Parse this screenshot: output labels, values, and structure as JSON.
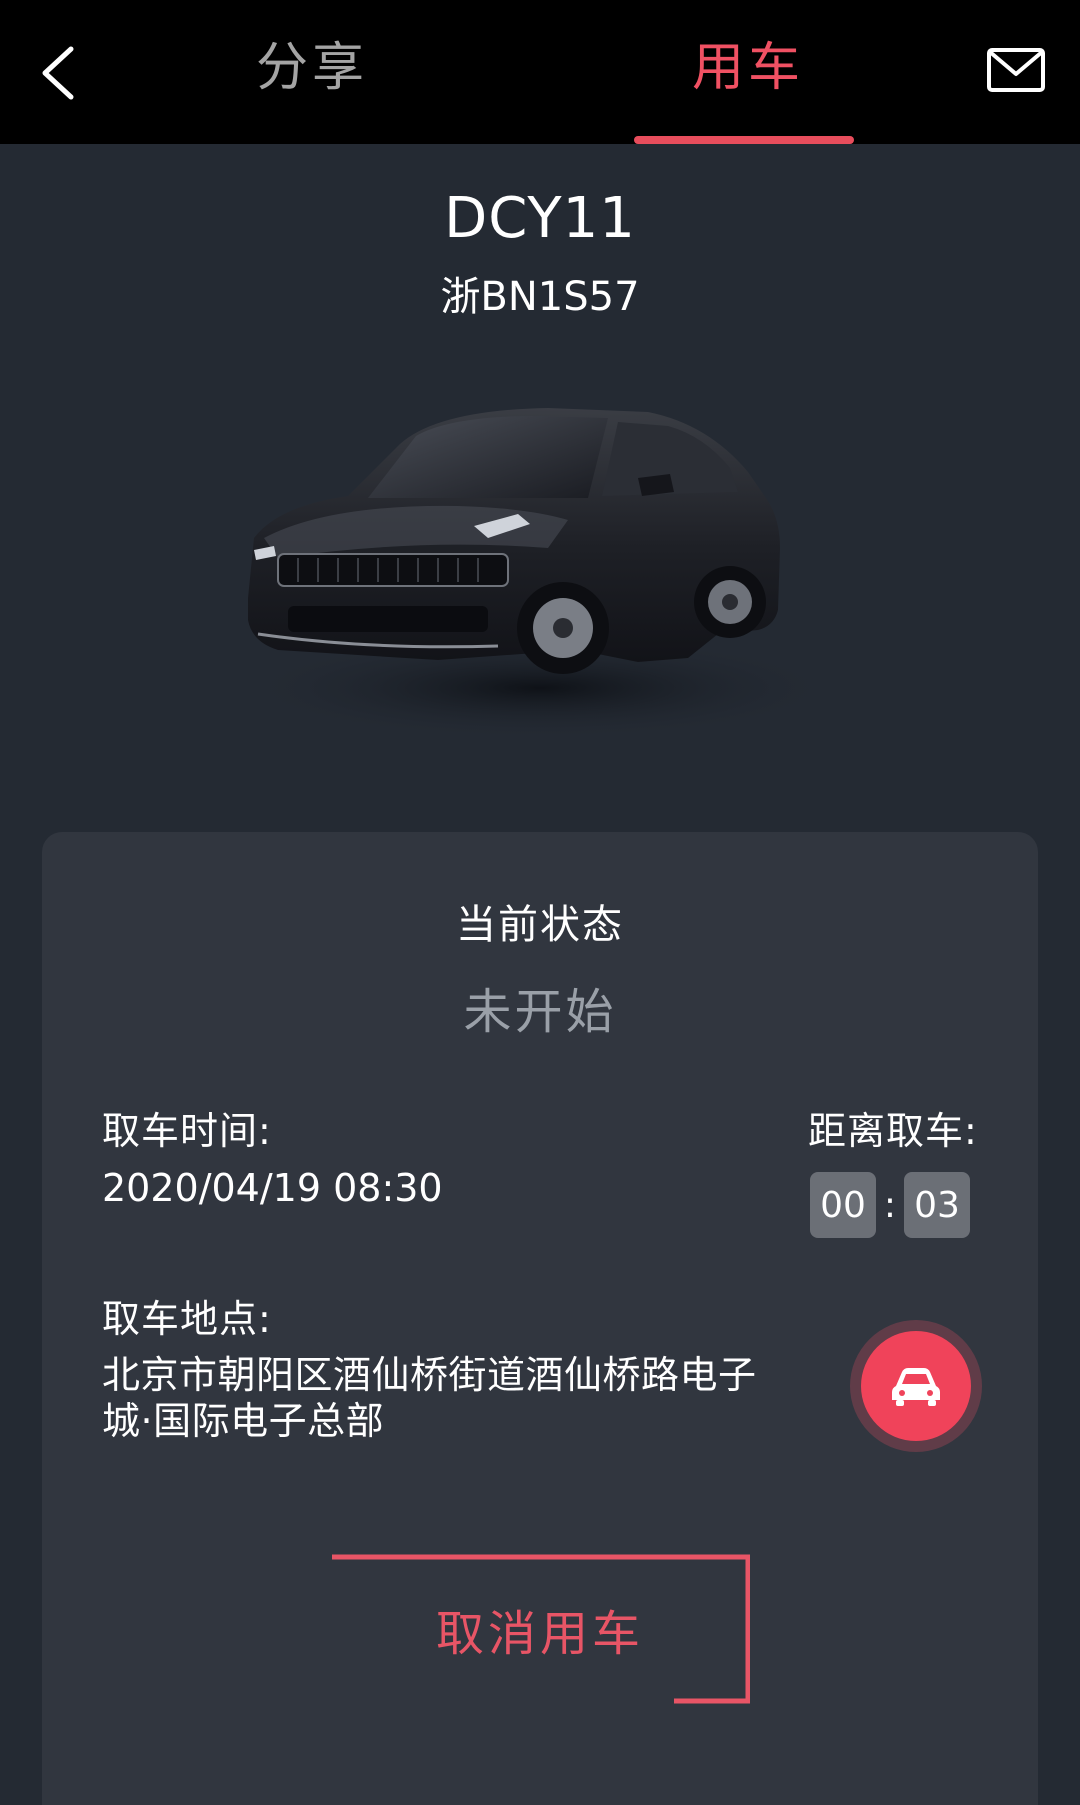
{
  "header": {
    "tab_share": "分享",
    "tab_use": "用车",
    "active_tab": "用车"
  },
  "vehicle": {
    "name": "DCY11",
    "plate": "浙BN1S57"
  },
  "status": {
    "title": "当前状态",
    "value": "未开始"
  },
  "pickup": {
    "time_label": "取车时间:",
    "time_value": "2020/04/19 08:30",
    "countdown_label": "距离取车:",
    "countdown_hours": "00",
    "countdown_separator": ":",
    "countdown_minutes": "03",
    "location_label": "取车地点:",
    "location_value": "北京市朝阳区酒仙桥街道酒仙桥路电子城·国际电子总部"
  },
  "actions": {
    "cancel_label": "取消用车"
  },
  "colors": {
    "accent": "#f05163",
    "background": "#242a33",
    "card": "#31363f",
    "header": "#000000"
  },
  "icons": {
    "back": "chevron-left-icon",
    "mail": "mail-icon",
    "navigate": "car-icon"
  }
}
